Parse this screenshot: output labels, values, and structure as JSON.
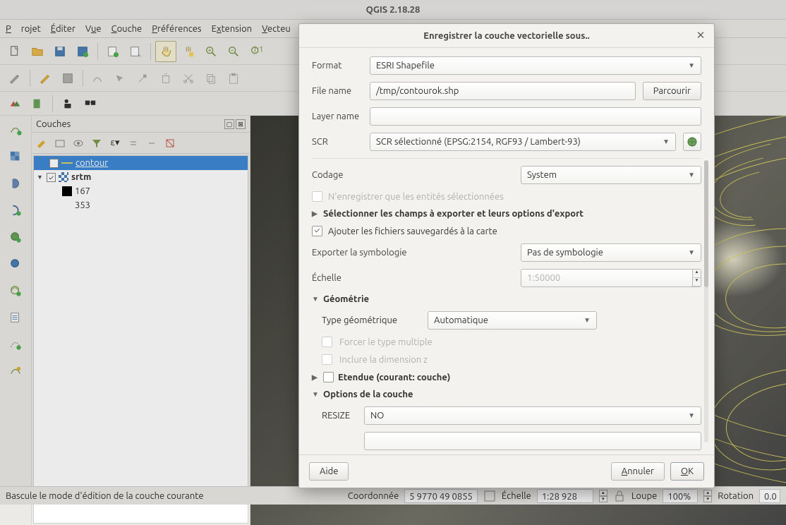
{
  "app": {
    "title": "QGIS 2.18.28"
  },
  "menus": [
    "Projet",
    "Éditer",
    "Vue",
    "Couche",
    "Préférences",
    "Extension",
    "Vecteu"
  ],
  "layers_panel": {
    "title": "Couches",
    "items": [
      {
        "name": "contour",
        "checked": true,
        "selected": true,
        "swatch": "#d8d060"
      },
      {
        "name": "srtm",
        "checked": true,
        "expanded": true,
        "swatch": "checker"
      },
      {
        "name": "167",
        "swatch": "#000"
      },
      {
        "name": "353"
      }
    ]
  },
  "status": {
    "hint": "Bascule le mode d'édition de la couche courante",
    "coord_label": "Coordonnée",
    "coord": "5 9770 49 0855",
    "scale_label": "Échelle",
    "scale": "1:28 928",
    "loupe_label": "Loupe",
    "loupe": "100%",
    "rotation_label": "Rotation",
    "rotation": "0.0"
  },
  "dialog": {
    "title": "Enregistrer la couche vectorielle sous..",
    "format_label": "Format",
    "format": "ESRI Shapefile",
    "filename_label": "File name",
    "filename": "/tmp/contourok.shp",
    "browse": "Parcourir",
    "layername_label": "Layer name",
    "layername": "",
    "scr_label": "SCR",
    "scr": "SCR sélectionné (EPSG:2154, RGF93 / Lambert-93)",
    "coding_label": "Codage",
    "coding": "System",
    "only_selected": "N'enregistrer que les entités sélectionnées",
    "select_fields": "Sélectionner les champs à exporter et leurs options d'export",
    "add_saved": "Ajouter les fichiers sauvegardés à la carte",
    "export_sym_label": "Exporter la symbologie",
    "export_sym": "Pas de symbologie",
    "scale_label": "Échelle",
    "scale": "1:50000",
    "geometry": "Géométrie",
    "geom_type_label": "Type géométrique",
    "geom_type": "Automatique",
    "force_multi": "Forcer le type multiple",
    "include_z": "Inclure la dimension z",
    "extent": "Etendue (courant: couche)",
    "layer_opts": "Options de la couche",
    "resize_label": "RESIZE",
    "resize": "NO",
    "help": "Aide",
    "cancel": "Annuler",
    "ok": "OK"
  }
}
